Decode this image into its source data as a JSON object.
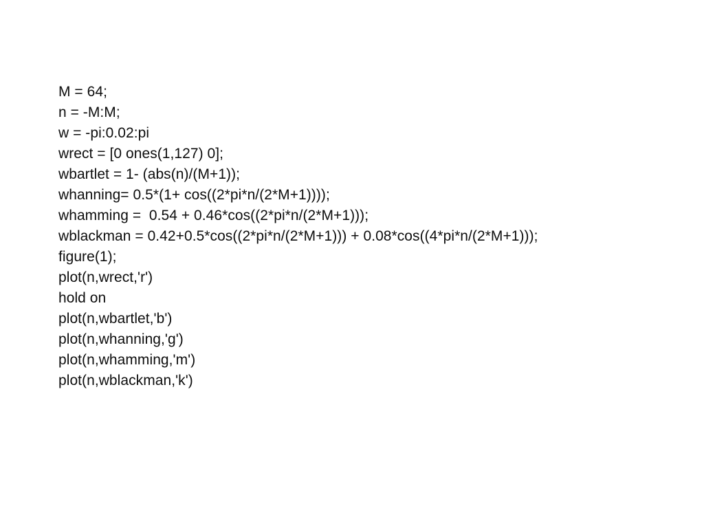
{
  "slide": {
    "background_color": "#ffffff",
    "text_color": "#0d0d0d",
    "code": {
      "language": "MATLAB",
      "lines": [
        "M = 64;",
        "n = -M:M;",
        "w = -pi:0.02:pi",
        "wrect = [0 ones(1,127) 0];",
        "wbartlet = 1- (abs(n)/(M+1));",
        "whanning= 0.5*(1+ cos((2*pi*n/(2*M+1))));",
        "whamming =  0.54 + 0.46*cos((2*pi*n/(2*M+1)));",
        "wblackman = 0.42+0.5*cos((2*pi*n/(2*M+1))) + 0.08*cos((4*pi*n/(2*M+1)));",
        "figure(1);",
        "plot(n,wrect,'r')",
        "hold on",
        "plot(n,wbartlet,'b')",
        "plot(n,whanning,'g')",
        "plot(n,whamming,'m')",
        "plot(n,wblackman,'k')"
      ]
    }
  }
}
